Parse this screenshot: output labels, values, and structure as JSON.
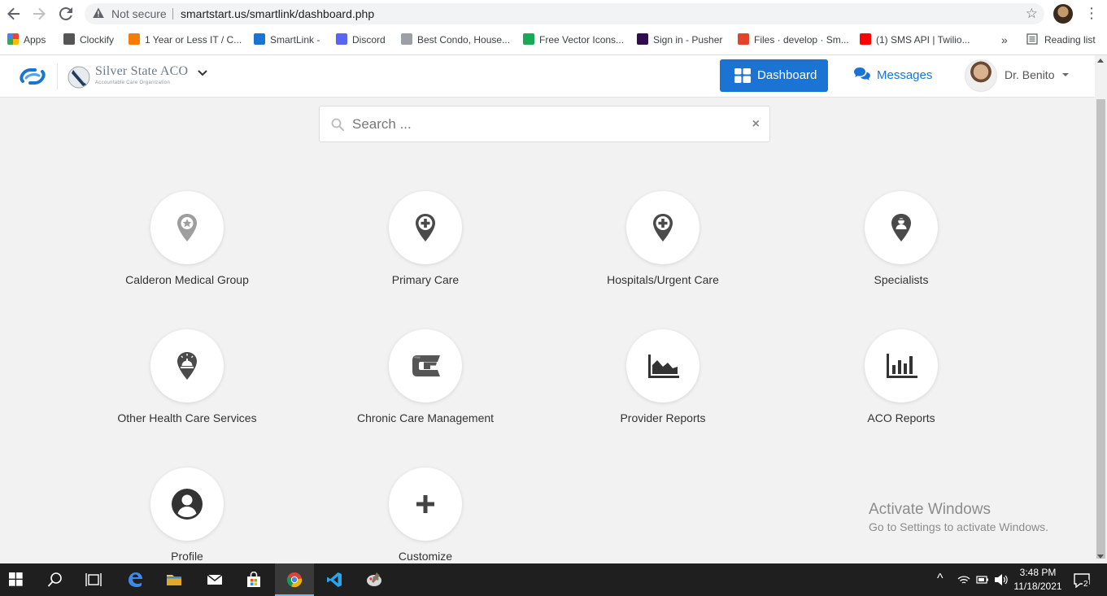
{
  "browser": {
    "security_label": "Not secure",
    "url": "smartstart.us/smartlink/dashboard.php",
    "bookmarks": [
      {
        "label": "Apps",
        "icon": "apps-grid-icon",
        "color": "#ea4335"
      },
      {
        "label": "Clockify",
        "icon": "clockify-icon",
        "color": "#555555"
      },
      {
        "label": "1 Year or Less IT / C...",
        "icon": "m-logo-icon",
        "color": "#f57c00"
      },
      {
        "label": "SmartLink -",
        "icon": "smartlink-icon",
        "color": "#1b74d4"
      },
      {
        "label": "Discord",
        "icon": "discord-icon",
        "color": "#5865f2"
      },
      {
        "label": "Best Condo, House...",
        "icon": "site-icon",
        "color": "#9aa0a6"
      },
      {
        "label": "Free Vector Icons...",
        "icon": "flaticon-icon",
        "color": "#18a957"
      },
      {
        "label": "Sign in - Pusher",
        "icon": "pusher-icon",
        "color": "#300d4f"
      },
      {
        "label": "Files · develop · Sm...",
        "icon": "gitlab-icon",
        "color": "#e24329"
      },
      {
        "label": "(1) SMS API | Twilio...",
        "icon": "youtube-icon",
        "color": "#ff0000"
      }
    ],
    "more_label": "»",
    "reading_list": "Reading list"
  },
  "header": {
    "org_name": "Silver State ACO",
    "org_tagline": "Accountable Care Organization",
    "dashboard_label": "Dashboard",
    "messages_label": "Messages",
    "user_name": "Dr. Benito"
  },
  "search": {
    "placeholder": "Search ...",
    "clear": "×"
  },
  "tiles": [
    {
      "label": "Calderon Medical Group",
      "icon": "star-pin-icon"
    },
    {
      "label": "Primary Care",
      "icon": "medical-pin-icon"
    },
    {
      "label": "Hospitals/Urgent Care",
      "icon": "medical-pin-icon"
    },
    {
      "label": "Specialists",
      "icon": "doctor-pin-icon"
    },
    {
      "label": "Other Health Care Services",
      "icon": "service-bell-pin-icon"
    },
    {
      "label": "Chronic Care Management",
      "icon": "ccm-logo-icon"
    },
    {
      "label": "Provider Reports",
      "icon": "area-chart-icon"
    },
    {
      "label": "ACO Reports",
      "icon": "bar-chart-icon"
    },
    {
      "label": "Profile",
      "icon": "user-circle-icon"
    },
    {
      "label": "Customize",
      "icon": "plus-icon"
    }
  ],
  "watermark": {
    "title": "Activate Windows",
    "subtitle": "Go to Settings to activate Windows."
  },
  "taskbar": {
    "time": "3:48 PM",
    "date": "11/18/2021",
    "notifications": "2"
  }
}
